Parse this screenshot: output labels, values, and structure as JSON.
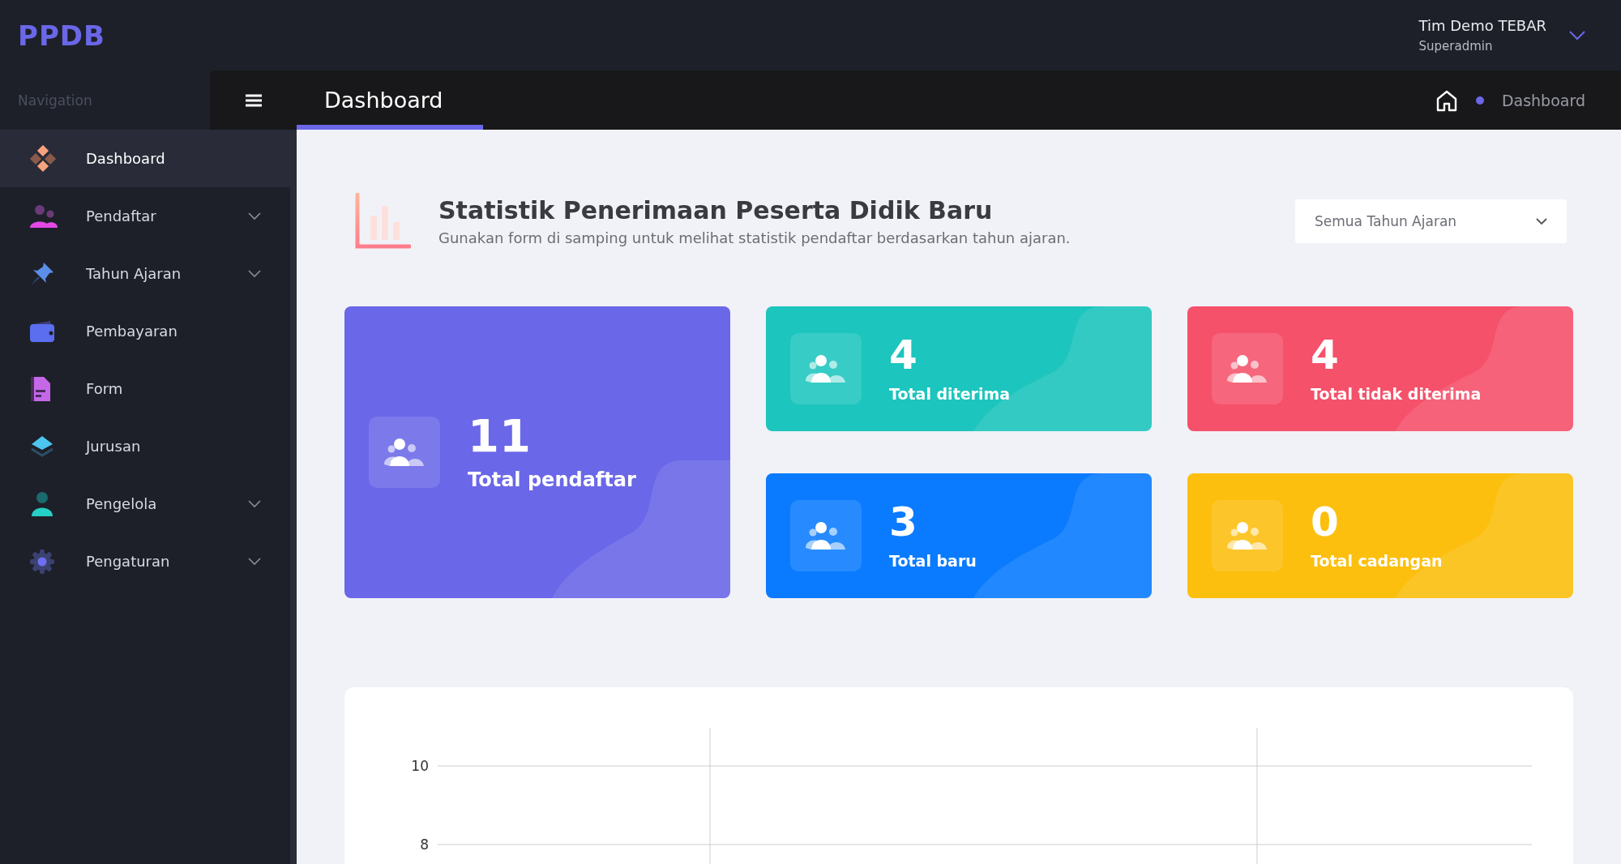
{
  "app": {
    "logo": "PPDB"
  },
  "user": {
    "name": "Tim Demo TEBAR",
    "role": "Superadmin"
  },
  "sidebar": {
    "heading": "Navigation",
    "items": [
      {
        "label": "Dashboard",
        "selected": true,
        "has_submenu": false
      },
      {
        "label": "Pendaftar",
        "selected": false,
        "has_submenu": true
      },
      {
        "label": "Tahun Ajaran",
        "selected": false,
        "has_submenu": true
      },
      {
        "label": "Pembayaran",
        "selected": false,
        "has_submenu": false
      },
      {
        "label": "Form",
        "selected": false,
        "has_submenu": false
      },
      {
        "label": "Jurusan",
        "selected": false,
        "has_submenu": false
      },
      {
        "label": "Pengelola",
        "selected": false,
        "has_submenu": true
      },
      {
        "label": "Pengaturan",
        "selected": false,
        "has_submenu": true
      }
    ]
  },
  "page_tab": {
    "label": "Dashboard"
  },
  "breadcrumb": {
    "items": [
      "Dashboard"
    ]
  },
  "header": {
    "title": "Statistik Penerimaan Peserta Didik Baru",
    "subtitle": "Gunakan form di samping untuk melihat statistik pendaftar berdasarkan tahun ajaran."
  },
  "year_select": {
    "value": "Semua Tahun Ajaran"
  },
  "stats": [
    {
      "kind": "large",
      "value": "11",
      "label": "Total pendaftar",
      "color": "#6a67e8"
    },
    {
      "kind": "small",
      "value": "4",
      "label": "Total diterima",
      "color": "#1cc5bd"
    },
    {
      "kind": "small",
      "value": "4",
      "label": "Total tidak diterima",
      "color": "#f5516a"
    },
    {
      "kind": "small",
      "value": "3",
      "label": "Total baru",
      "color": "#0a7bff"
    },
    {
      "kind": "small",
      "value": "0",
      "label": "Total cadangan",
      "color": "#fcbf0e"
    }
  ],
  "chart": {
    "y_axis_labels": [
      "10",
      "8"
    ]
  }
}
